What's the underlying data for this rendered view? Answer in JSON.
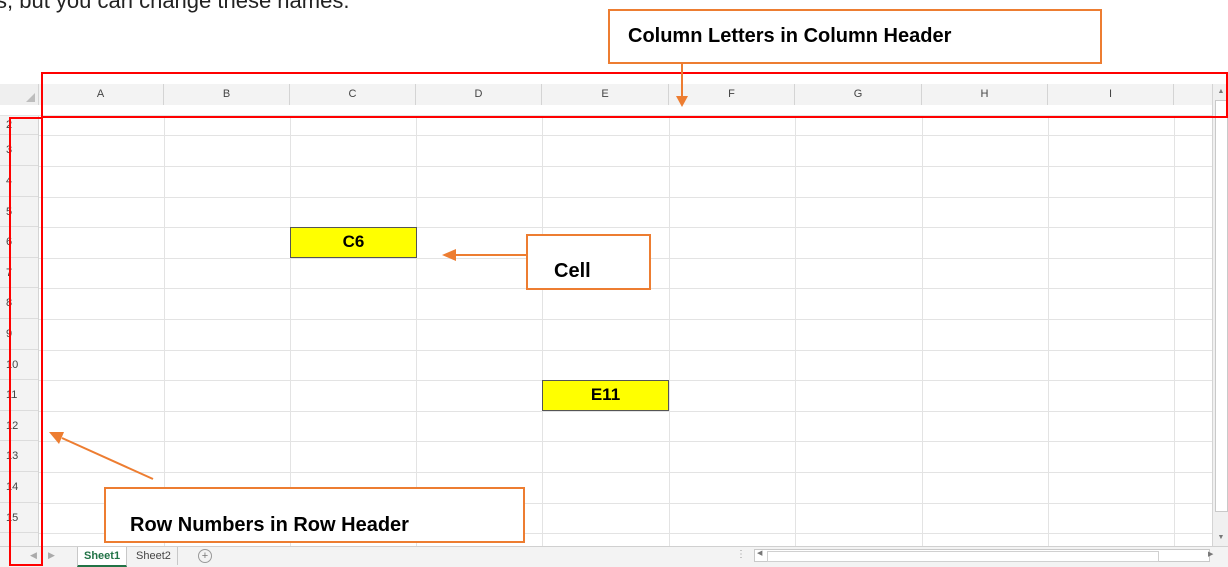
{
  "intro_text": "s, but you can change these names.",
  "column_headers": [
    "A",
    "B",
    "C",
    "D",
    "E",
    "F",
    "G",
    "H",
    "I"
  ],
  "row_headers": [
    "2",
    "3",
    "4",
    "5",
    "6",
    "7",
    "8",
    "9",
    "10",
    "11",
    "12",
    "13",
    "14",
    "15"
  ],
  "cells": {
    "c6": "C6",
    "e11": "E11"
  },
  "cell_fill_color": "#ffff00",
  "annotations": {
    "column_header_label": "Column Letters in Column Header",
    "cell_label": "Cell",
    "row_header_label": "Row Numbers in Row Header",
    "box_color": "#ff0000",
    "callout_color": "#ed7d31"
  },
  "sheet_tabs": [
    {
      "label": "Sheet1",
      "active": true
    },
    {
      "label": "Sheet2",
      "active": false
    }
  ],
  "add_sheet_symbol": "+",
  "icons": [
    "select-all-triangle-icon",
    "scroll-up-icon",
    "scroll-down-icon",
    "scroll-left-icon",
    "scroll-right-icon",
    "add-sheet-icon",
    "tab-nav-left-icon",
    "tab-nav-right-icon"
  ]
}
